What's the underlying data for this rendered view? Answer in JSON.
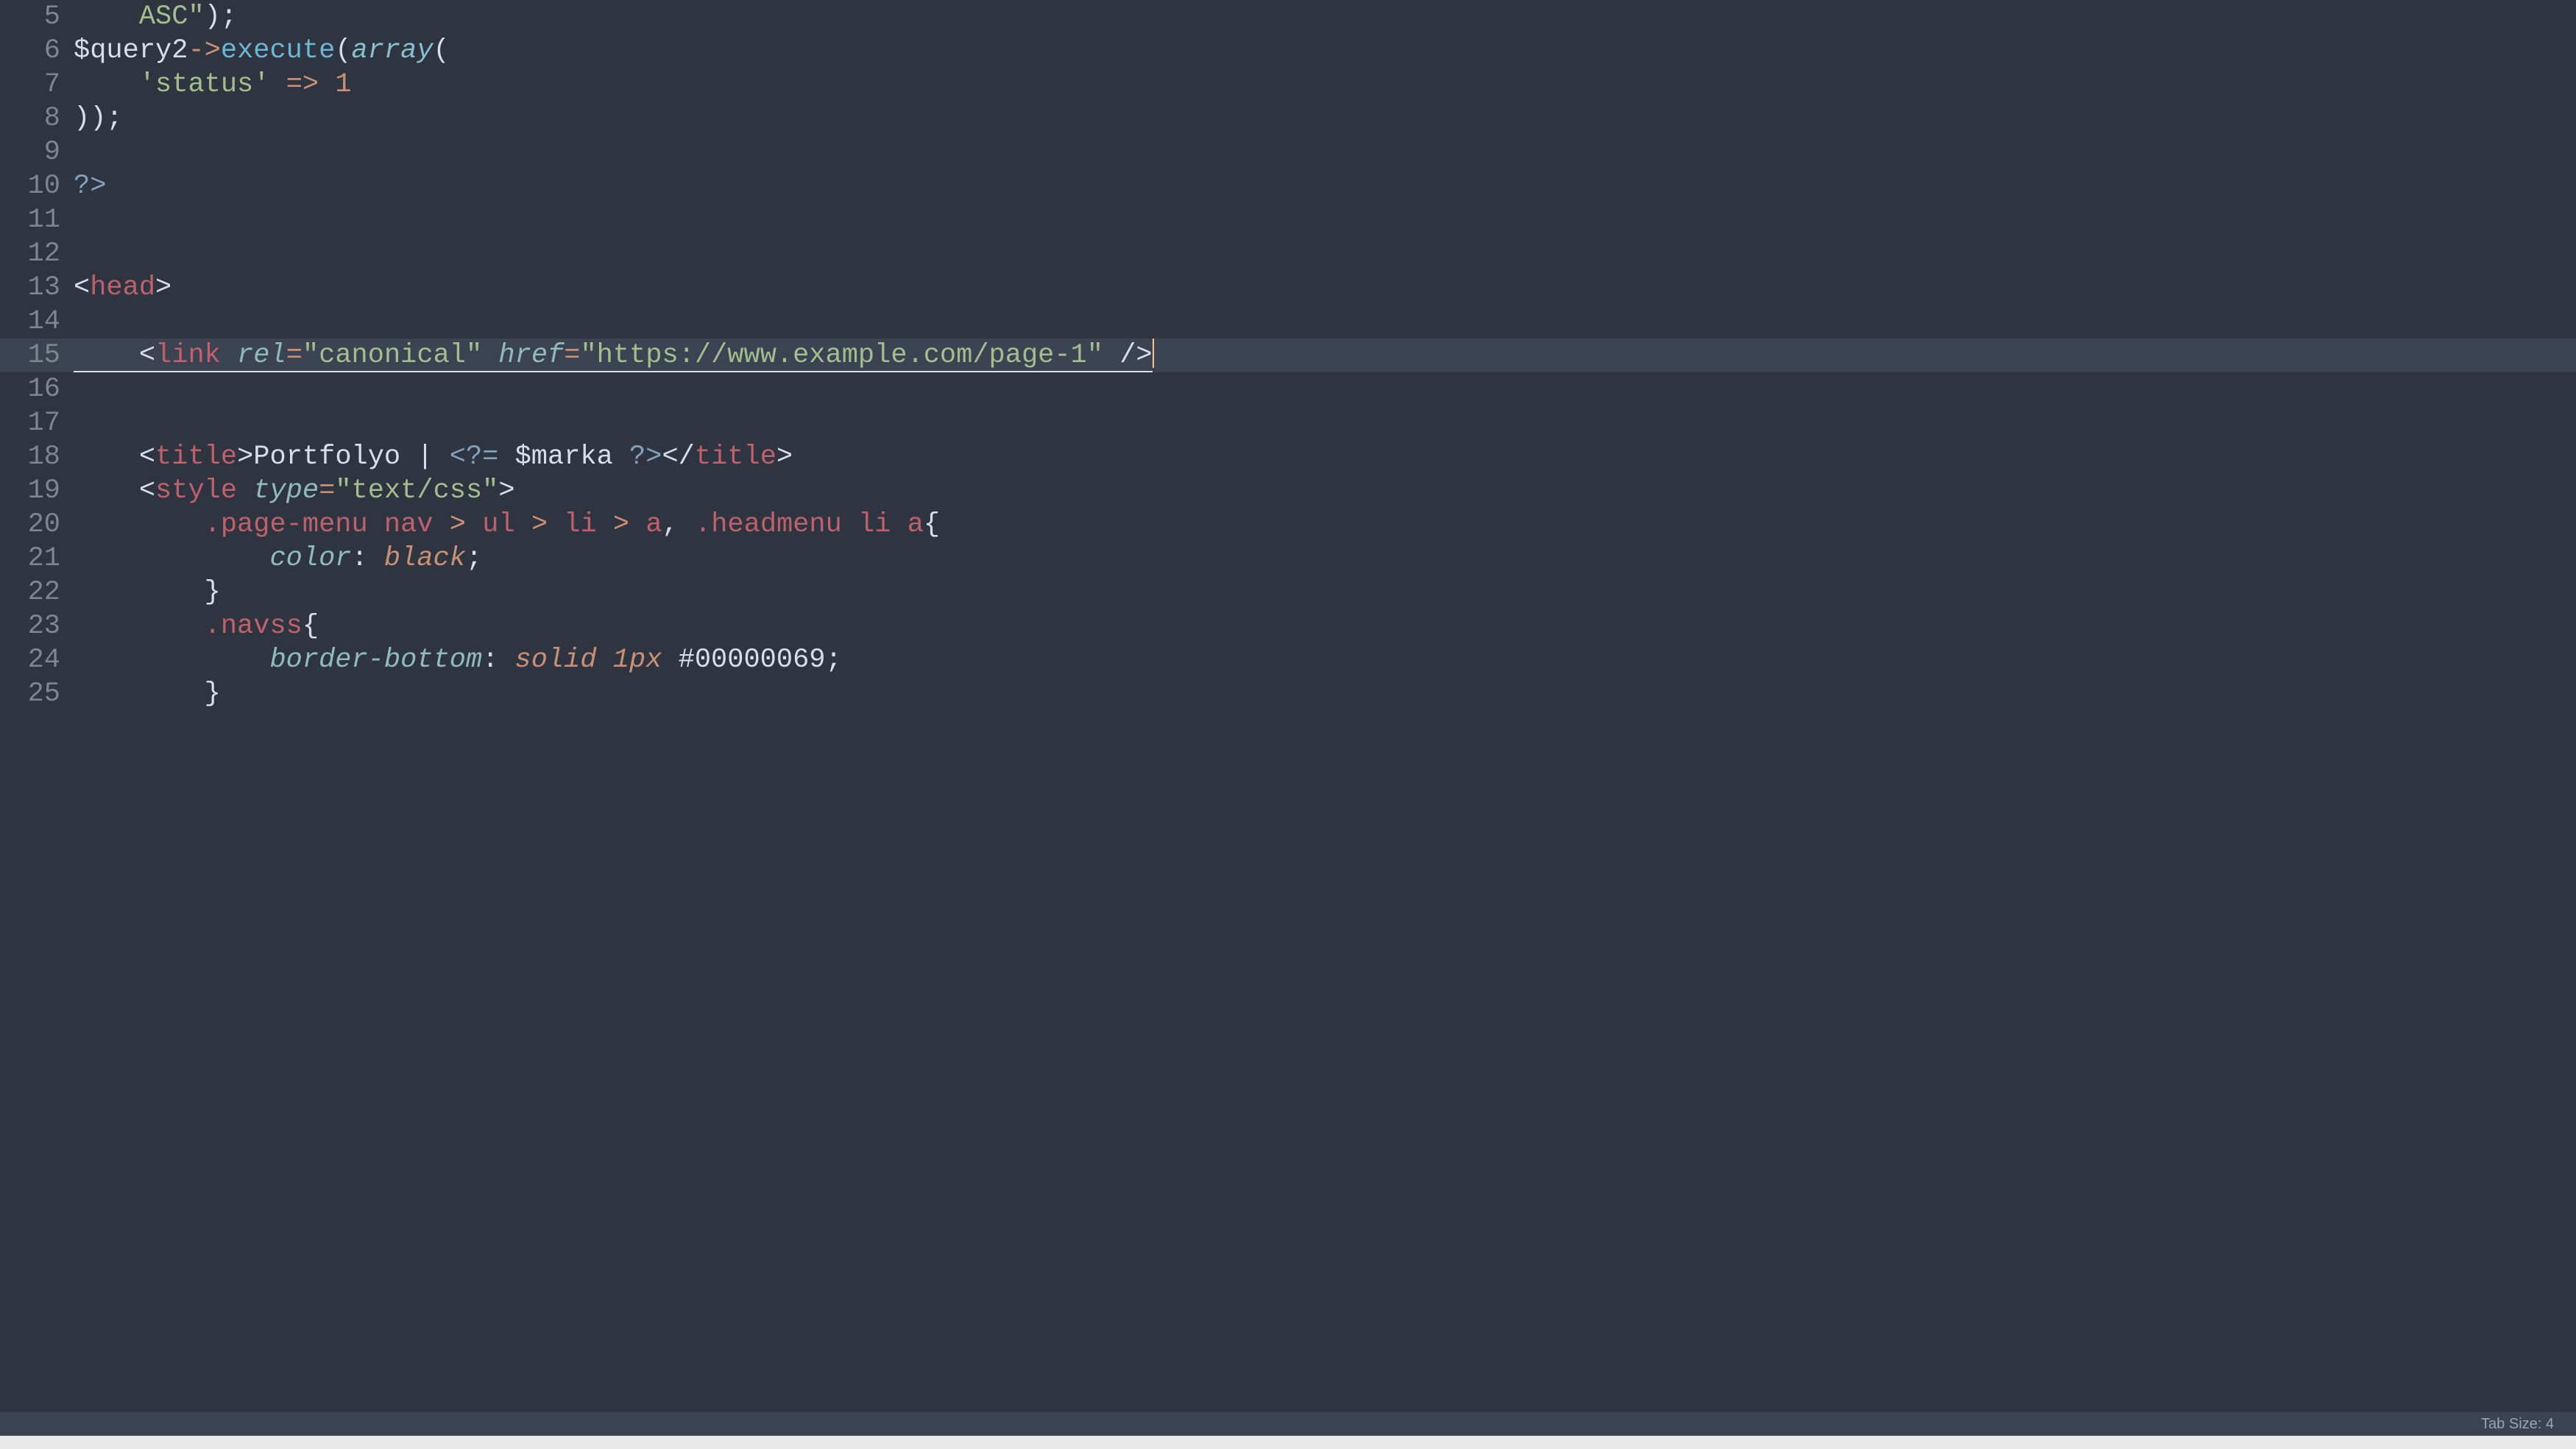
{
  "editor": {
    "active_line": 15,
    "lines": {
      "5": {
        "indent": "    ",
        "tokens": [
          {
            "t": "ASC\"",
            "c": "tok-str"
          },
          {
            "t": ")",
            "c": "tok-punc"
          },
          {
            "t": ";",
            "c": "tok-punc"
          }
        ]
      },
      "6": {
        "indent": "",
        "tokens": [
          {
            "t": "$query2",
            "c": "tok-var"
          },
          {
            "t": "->",
            "c": "tok-arrow"
          },
          {
            "t": "execute",
            "c": "tok-func"
          },
          {
            "t": "(",
            "c": "tok-punc"
          },
          {
            "t": "array",
            "c": "tok-builtin"
          },
          {
            "t": "(",
            "c": "tok-punc"
          }
        ]
      },
      "7": {
        "indent": "    ",
        "tokens": [
          {
            "t": "'status'",
            "c": "tok-str"
          },
          {
            "t": " ",
            "c": "tok-punc"
          },
          {
            "t": "=>",
            "c": "tok-arrow"
          },
          {
            "t": " ",
            "c": "tok-punc"
          },
          {
            "t": "1",
            "c": "tok-num"
          }
        ]
      },
      "8": {
        "indent": "",
        "tokens": [
          {
            "t": "))",
            "c": "tok-punc"
          },
          {
            "t": ";",
            "c": "tok-punc"
          }
        ]
      },
      "9": {
        "indent": "",
        "tokens": []
      },
      "10": {
        "indent": "",
        "tokens": [
          {
            "t": "?>",
            "c": "tok-php"
          }
        ]
      },
      "11": {
        "indent": "",
        "tokens": []
      },
      "12": {
        "indent": "",
        "tokens": []
      },
      "13": {
        "indent": "",
        "tokens": [
          {
            "t": "<",
            "c": "tok-bracket"
          },
          {
            "t": "head",
            "c": "tok-tag"
          },
          {
            "t": ">",
            "c": "tok-bracket"
          }
        ]
      },
      "14": {
        "indent": "",
        "tokens": []
      },
      "15": {
        "indent": "    ",
        "underline": true,
        "cursor_after": true,
        "tokens": [
          {
            "t": "<",
            "c": "tok-bracket"
          },
          {
            "t": "link",
            "c": "tok-tag"
          },
          {
            "t": " ",
            "c": ""
          },
          {
            "t": "rel",
            "c": "tok-attr"
          },
          {
            "t": "=",
            "c": "tok-arrow"
          },
          {
            "t": "\"canonical\"",
            "c": "tok-str"
          },
          {
            "t": " ",
            "c": ""
          },
          {
            "t": "href",
            "c": "tok-attr"
          },
          {
            "t": "=",
            "c": "tok-arrow"
          },
          {
            "t": "\"https://www.example.com/page-1\"",
            "c": "tok-str"
          },
          {
            "t": " ",
            "c": ""
          },
          {
            "t": "/>",
            "c": "tok-bracket"
          }
        ]
      },
      "16": {
        "indent": "",
        "tokens": []
      },
      "17": {
        "indent": "",
        "tokens": []
      },
      "18": {
        "indent": "    ",
        "tokens": [
          {
            "t": "<",
            "c": "tok-bracket"
          },
          {
            "t": "title",
            "c": "tok-tag"
          },
          {
            "t": ">",
            "c": "tok-bracket"
          },
          {
            "t": "Portfolyo | ",
            "c": "tok-punc"
          },
          {
            "t": "<?=",
            "c": "tok-php"
          },
          {
            "t": " ",
            "c": ""
          },
          {
            "t": "$marka",
            "c": "tok-var"
          },
          {
            "t": " ",
            "c": ""
          },
          {
            "t": "?>",
            "c": "tok-php"
          },
          {
            "t": "</",
            "c": "tok-bracket"
          },
          {
            "t": "title",
            "c": "tok-tag"
          },
          {
            "t": ">",
            "c": "tok-bracket"
          }
        ]
      },
      "19": {
        "indent": "    ",
        "tokens": [
          {
            "t": "<",
            "c": "tok-bracket"
          },
          {
            "t": "style",
            "c": "tok-tag"
          },
          {
            "t": " ",
            "c": ""
          },
          {
            "t": "type",
            "c": "tok-attr"
          },
          {
            "t": "=",
            "c": "tok-arrow"
          },
          {
            "t": "\"text/css\"",
            "c": "tok-str"
          },
          {
            "t": ">",
            "c": "tok-bracket"
          }
        ]
      },
      "20": {
        "indent": "        ",
        "tokens": [
          {
            "t": ".page-menu",
            "c": "tok-css-sel"
          },
          {
            "t": " ",
            "c": ""
          },
          {
            "t": "nav",
            "c": "tok-css-tag"
          },
          {
            "t": " ",
            "c": ""
          },
          {
            "t": ">",
            "c": "tok-arrow"
          },
          {
            "t": " ",
            "c": ""
          },
          {
            "t": "ul",
            "c": "tok-css-tag"
          },
          {
            "t": " ",
            "c": ""
          },
          {
            "t": ">",
            "c": "tok-arrow"
          },
          {
            "t": " ",
            "c": ""
          },
          {
            "t": "li",
            "c": "tok-css-tag"
          },
          {
            "t": " ",
            "c": ""
          },
          {
            "t": ">",
            "c": "tok-arrow"
          },
          {
            "t": " ",
            "c": ""
          },
          {
            "t": "a",
            "c": "tok-css-tag"
          },
          {
            "t": ",",
            "c": "tok-punc"
          },
          {
            "t": " ",
            "c": ""
          },
          {
            "t": ".headmenu",
            "c": "tok-css-sel"
          },
          {
            "t": " ",
            "c": ""
          },
          {
            "t": "li",
            "c": "tok-css-tag"
          },
          {
            "t": " ",
            "c": ""
          },
          {
            "t": "a",
            "c": "tok-css-tag"
          },
          {
            "t": "{",
            "c": "tok-punc"
          }
        ]
      },
      "21": {
        "indent": "            ",
        "tokens": [
          {
            "t": "color",
            "c": "tok-css-prop"
          },
          {
            "t": ":",
            "c": "tok-punc"
          },
          {
            "t": " ",
            "c": ""
          },
          {
            "t": "black",
            "c": "tok-css-val"
          },
          {
            "t": ";",
            "c": "tok-punc"
          }
        ]
      },
      "22": {
        "indent": "        ",
        "tokens": [
          {
            "t": "}",
            "c": "tok-punc"
          }
        ]
      },
      "23": {
        "indent": "        ",
        "tokens": [
          {
            "t": ".navss",
            "c": "tok-css-sel"
          },
          {
            "t": "{",
            "c": "tok-punc"
          }
        ]
      },
      "24": {
        "indent": "            ",
        "tokens": [
          {
            "t": "border-bottom",
            "c": "tok-css-prop"
          },
          {
            "t": ":",
            "c": "tok-punc"
          },
          {
            "t": " ",
            "c": ""
          },
          {
            "t": "solid",
            "c": "tok-css-val"
          },
          {
            "t": " ",
            "c": ""
          },
          {
            "t": "1px",
            "c": "tok-css-val"
          },
          {
            "t": " ",
            "c": ""
          },
          {
            "t": "#00000069",
            "c": "tok-css-color"
          },
          {
            "t": ";",
            "c": "tok-punc"
          }
        ]
      },
      "25": {
        "indent": "        ",
        "tokens": [
          {
            "t": "}",
            "c": "tok-punc"
          }
        ]
      }
    },
    "line_order": [
      5,
      6,
      7,
      8,
      9,
      10,
      11,
      12,
      13,
      14,
      15,
      16,
      17,
      18,
      19,
      20,
      21,
      22,
      23,
      24,
      25
    ]
  },
  "statusbar": {
    "tab_size": "Tab Size: 4"
  }
}
